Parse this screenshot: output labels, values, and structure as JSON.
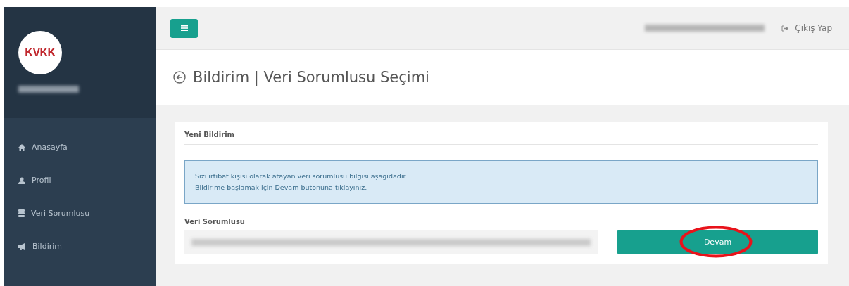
{
  "sidebar": {
    "logo": "KVKK",
    "items": [
      {
        "label": "Anasayfa",
        "selected": false
      },
      {
        "label": "Profil",
        "selected": false
      },
      {
        "label": "Veri Sorumlusu",
        "selected": false
      },
      {
        "label": "Bildirim",
        "selected": false
      }
    ]
  },
  "header": {
    "logout": "Çıkış Yap"
  },
  "page_title": "Bildirim | Veri Sorumlusu Seçimi",
  "panel": {
    "title": "Yeni Bildirim",
    "info": [
      "Sizi irtibat kişisi olarak atayan veri sorumlusu bilgisi aşağıdadır.",
      "Bildirime başlamak için Devam butonuna tıklayınız."
    ],
    "field_label": "Veri Sorumlusu",
    "button": "Devam"
  }
}
